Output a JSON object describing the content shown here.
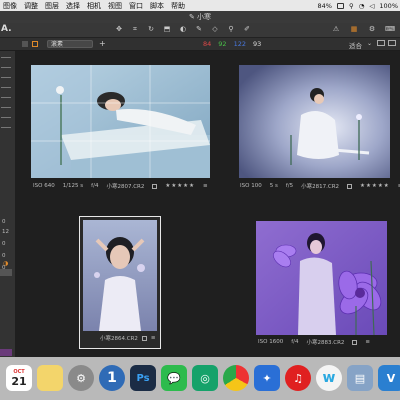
{
  "menubar": {
    "items": [
      "图像",
      "调整",
      "图层",
      "选择",
      "相机",
      "视图",
      "窗口",
      "脚本",
      "帮助"
    ],
    "battery": "84%",
    "status_pct": "100%",
    "icons": [
      "zoom-icon",
      "wifi-icon",
      "volume-icon"
    ]
  },
  "window": {
    "title": "小寒"
  },
  "toolbar": {
    "logo": "A.",
    "tools": [
      "hand-icon",
      "crop-icon",
      "rotate-icon",
      "keystone-icon",
      "mask-icon",
      "brush-icon",
      "eraser-icon",
      "eyedropper-icon",
      "text-icon"
    ],
    "right_icons": [
      "warning-icon",
      "histogram-icon",
      "gear-icon",
      "keyboard-icon"
    ]
  },
  "subbar": {
    "selector": "滚素",
    "plus": "+",
    "counts": [
      {
        "value": "84",
        "color": "#e04848"
      },
      {
        "value": "92",
        "color": "#48c048"
      },
      {
        "value": "122",
        "color": "#4878e0"
      },
      {
        "value": "93",
        "color": "#dddddd"
      }
    ],
    "fit_label": "适合",
    "view_buttons": [
      "grid-view",
      "filmstrip-view"
    ]
  },
  "leftpanel": {
    "nums": [
      "0",
      "12",
      "0",
      "0",
      "0"
    ]
  },
  "thumbnails": [
    {
      "id": "photo1",
      "iso": "ISO 640",
      "shutter": "1/125 s",
      "aperture": "f/4",
      "filename": "小寒2807.CR2",
      "stars": "★★★★★",
      "selected": false
    },
    {
      "id": "photo2",
      "iso": "ISO 100",
      "shutter": "5 s",
      "aperture": "f/5",
      "filename": "小寒2817.CR2",
      "stars": "★★★★★",
      "selected": false
    },
    {
      "id": "photo3",
      "filename": "小寒2864.CR2",
      "selected": true
    },
    {
      "id": "photo4",
      "iso": "ISO 1600",
      "aperture": "f/4",
      "filename": "小寒2883.CR2",
      "selected": false
    }
  ],
  "dock": {
    "apps": [
      {
        "name": "calendar",
        "label": "21",
        "sub": "OCT"
      },
      {
        "name": "notes",
        "label": ""
      },
      {
        "name": "system-preferences",
        "label": "⚙"
      },
      {
        "name": "1password",
        "label": "1"
      },
      {
        "name": "photoshop",
        "label": "Ps"
      },
      {
        "name": "wechat",
        "label": "💬"
      },
      {
        "name": "green-app",
        "label": "◎"
      },
      {
        "name": "chrome",
        "label": ""
      },
      {
        "name": "pin-app",
        "label": "✦"
      },
      {
        "name": "netease-music",
        "label": "♫"
      },
      {
        "name": "wc-app",
        "label": "w"
      },
      {
        "name": "preview",
        "label": "▤"
      },
      {
        "name": "sv-app",
        "label": "V"
      }
    ]
  }
}
